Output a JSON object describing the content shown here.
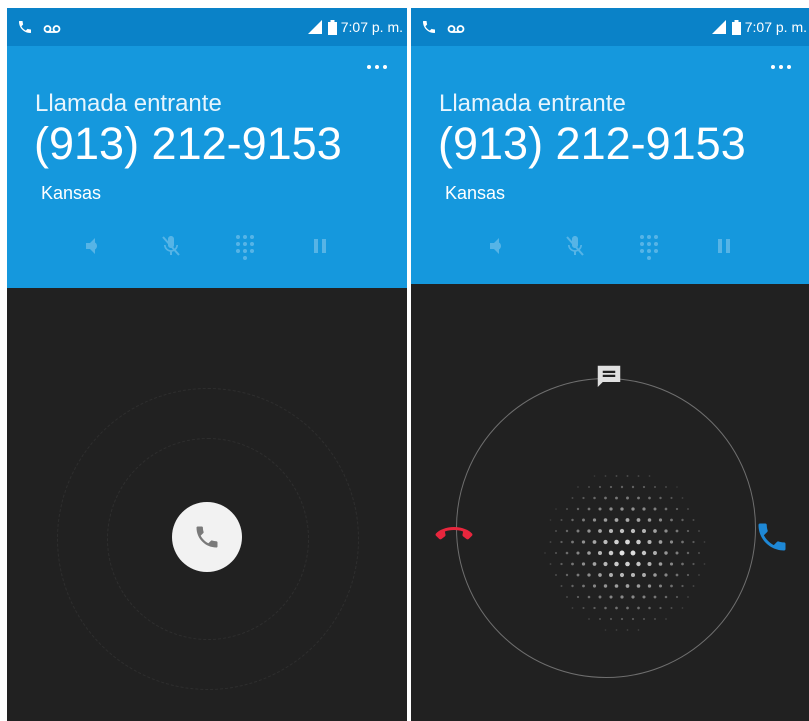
{
  "status_bar": {
    "time": "7:07 p. m.",
    "icons": [
      "phone-icon",
      "voicemail-icon",
      "signal-icon",
      "battery-icon"
    ]
  },
  "call": {
    "label": "Llamada entrante",
    "number": "(913) 212-9153",
    "location": "Kansas"
  },
  "action_icons": [
    "speaker-icon",
    "mute-icon",
    "dialpad-icon",
    "hold-icon"
  ],
  "colors": {
    "status_bar": "#0a82c8",
    "header": "#1598dd",
    "background": "#212121",
    "decline": "#e8263d",
    "accept": "#1e88d6"
  }
}
